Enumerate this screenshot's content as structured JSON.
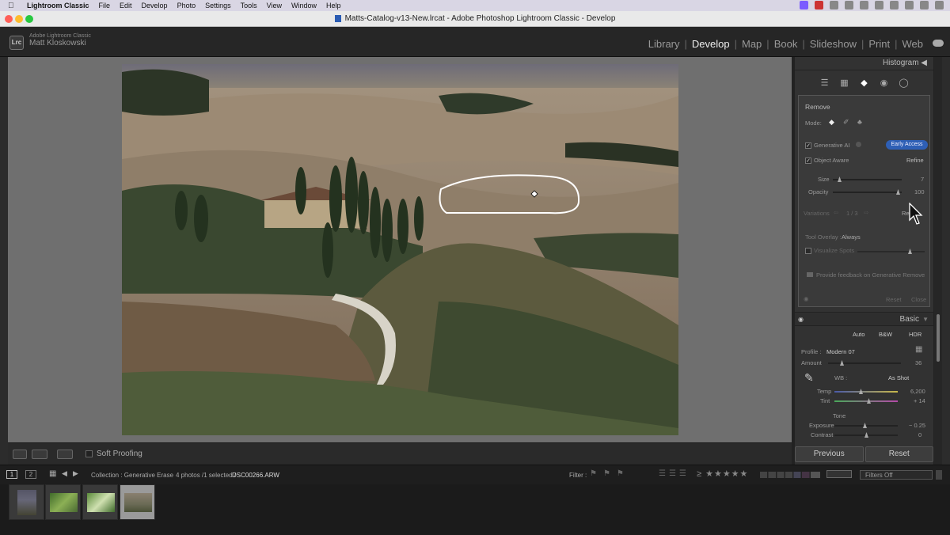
{
  "menubar": {
    "app": "Lightroom Classic",
    "items": [
      "File",
      "Edit",
      "Develop",
      "Photo",
      "Settings",
      "Tools",
      "View",
      "Window",
      "Help"
    ]
  },
  "window": {
    "title": "Matts-Catalog-v13-New.lrcat - Adobe Photoshop Lightroom Classic - Develop"
  },
  "identity": {
    "logo": "Lrc",
    "product": "Adobe Lightroom Classic",
    "user": "Matt Kloskowski"
  },
  "modules": [
    "Library",
    "Develop",
    "Map",
    "Book",
    "Slideshow",
    "Print",
    "Web"
  ],
  "active_module": "Develop",
  "histogram_label": "Histogram",
  "remove_panel": {
    "title": "Remove",
    "mode_label": "Mode:",
    "generative_ai": "Generative AI",
    "early_access": "Early Access",
    "object_aware": "Object Aware",
    "refine": "Refine",
    "size_label": "Size",
    "size_value": "7",
    "opacity_label": "Opacity",
    "opacity_value": "100",
    "variations_label": "Variations",
    "variations_count": "1 / 3",
    "variations_refine": "Refi",
    "tool_overlay_label": "Tool Overlay :",
    "tool_overlay_value": "Always",
    "visualize_spots": "Visualize Spots",
    "feedback": "Provide feedback on Generative Remove",
    "reset": "Reset",
    "close": "Close"
  },
  "basic_panel": {
    "title": "Basic",
    "auto": "Auto",
    "bw": "B&W",
    "hdr": "HDR",
    "profile_label": "Profile :",
    "profile_value": "Modern 07",
    "amount_label": "Amount",
    "amount_value": "36",
    "wb_label": "WB :",
    "wb_value": "As Shot",
    "temp_label": "Temp",
    "temp_value": "6,200",
    "tint_label": "Tint",
    "tint_value": "+ 14",
    "tone_label": "Tone",
    "exposure_label": "Exposure",
    "exposure_value": "− 0.25",
    "contrast_label": "Contrast",
    "contrast_value": "0"
  },
  "buttons": {
    "previous": "Previous",
    "reset": "Reset"
  },
  "toolbar": {
    "soft_proofing": "Soft Proofing"
  },
  "filmbar": {
    "screen1": "1",
    "screen2": "2",
    "collection": "Collection : Generative Erase",
    "count": "4 photos /1 selected /",
    "filename": "DSC00266.ARW",
    "filter_label": "Filter :",
    "filters_off": "Filters Off"
  },
  "colors": {
    "accent": "#2e5fb5",
    "panel": "#323232",
    "background": "#6f6f6f"
  },
  "icons": [
    "apple-icon",
    "edit-icon",
    "crop-icon",
    "eraser-icon",
    "redeye-icon",
    "masking-icon",
    "eyedropper-icon",
    "cloud-icon",
    "grid-icon",
    "cursor-icon"
  ]
}
